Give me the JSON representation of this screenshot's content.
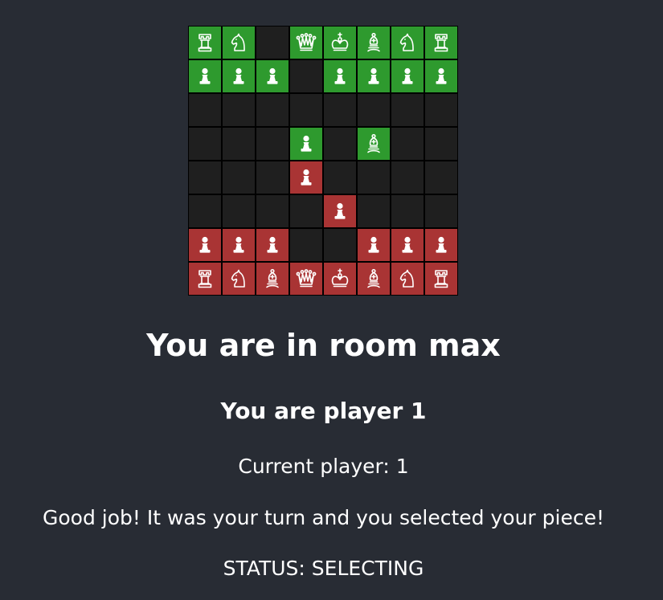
{
  "board": {
    "colors": {
      "player1": "#2e9a2e",
      "player2": "#a93434",
      "empty": "#1f1f1f",
      "piece": "#ffffff"
    },
    "cells": [
      [
        {
          "piece": "rook",
          "owner": "green"
        },
        {
          "piece": "knight",
          "owner": "green"
        },
        {
          "piece": "",
          "owner": ""
        },
        {
          "piece": "queen",
          "owner": "green"
        },
        {
          "piece": "king",
          "owner": "green"
        },
        {
          "piece": "bishop",
          "owner": "green"
        },
        {
          "piece": "knight",
          "owner": "green"
        },
        {
          "piece": "rook",
          "owner": "green"
        }
      ],
      [
        {
          "piece": "pawn",
          "owner": "green"
        },
        {
          "piece": "pawn",
          "owner": "green"
        },
        {
          "piece": "pawn",
          "owner": "green"
        },
        {
          "piece": "",
          "owner": ""
        },
        {
          "piece": "pawn",
          "owner": "green"
        },
        {
          "piece": "pawn",
          "owner": "green"
        },
        {
          "piece": "pawn",
          "owner": "green"
        },
        {
          "piece": "pawn",
          "owner": "green"
        }
      ],
      [
        {
          "piece": "",
          "owner": ""
        },
        {
          "piece": "",
          "owner": ""
        },
        {
          "piece": "",
          "owner": ""
        },
        {
          "piece": "",
          "owner": ""
        },
        {
          "piece": "",
          "owner": ""
        },
        {
          "piece": "",
          "owner": ""
        },
        {
          "piece": "",
          "owner": ""
        },
        {
          "piece": "",
          "owner": ""
        }
      ],
      [
        {
          "piece": "",
          "owner": ""
        },
        {
          "piece": "",
          "owner": ""
        },
        {
          "piece": "",
          "owner": ""
        },
        {
          "piece": "pawn",
          "owner": "green"
        },
        {
          "piece": "",
          "owner": ""
        },
        {
          "piece": "bishop",
          "owner": "green"
        },
        {
          "piece": "",
          "owner": ""
        },
        {
          "piece": "",
          "owner": ""
        }
      ],
      [
        {
          "piece": "",
          "owner": ""
        },
        {
          "piece": "",
          "owner": ""
        },
        {
          "piece": "",
          "owner": ""
        },
        {
          "piece": "pawn",
          "owner": "red"
        },
        {
          "piece": "",
          "owner": ""
        },
        {
          "piece": "",
          "owner": ""
        },
        {
          "piece": "",
          "owner": ""
        },
        {
          "piece": "",
          "owner": ""
        }
      ],
      [
        {
          "piece": "",
          "owner": ""
        },
        {
          "piece": "",
          "owner": ""
        },
        {
          "piece": "",
          "owner": ""
        },
        {
          "piece": "",
          "owner": ""
        },
        {
          "piece": "pawn",
          "owner": "red"
        },
        {
          "piece": "",
          "owner": ""
        },
        {
          "piece": "",
          "owner": ""
        },
        {
          "piece": "",
          "owner": ""
        }
      ],
      [
        {
          "piece": "pawn",
          "owner": "red"
        },
        {
          "piece": "pawn",
          "owner": "red"
        },
        {
          "piece": "pawn",
          "owner": "red"
        },
        {
          "piece": "",
          "owner": ""
        },
        {
          "piece": "",
          "owner": ""
        },
        {
          "piece": "pawn",
          "owner": "red"
        },
        {
          "piece": "pawn",
          "owner": "red"
        },
        {
          "piece": "pawn",
          "owner": "red"
        }
      ],
      [
        {
          "piece": "rook",
          "owner": "red"
        },
        {
          "piece": "knight",
          "owner": "red"
        },
        {
          "piece": "bishop",
          "owner": "red"
        },
        {
          "piece": "queen",
          "owner": "red"
        },
        {
          "piece": "king",
          "owner": "red"
        },
        {
          "piece": "bishop",
          "owner": "red"
        },
        {
          "piece": "knight",
          "owner": "red"
        },
        {
          "piece": "rook",
          "owner": "red"
        }
      ]
    ]
  },
  "room": {
    "title": "You are in room max",
    "player_label": "You are player 1",
    "current_player": "Current player: 1",
    "message": "Good job! It was your turn and you selected your piece!",
    "status": "STATUS: SELECTING"
  }
}
